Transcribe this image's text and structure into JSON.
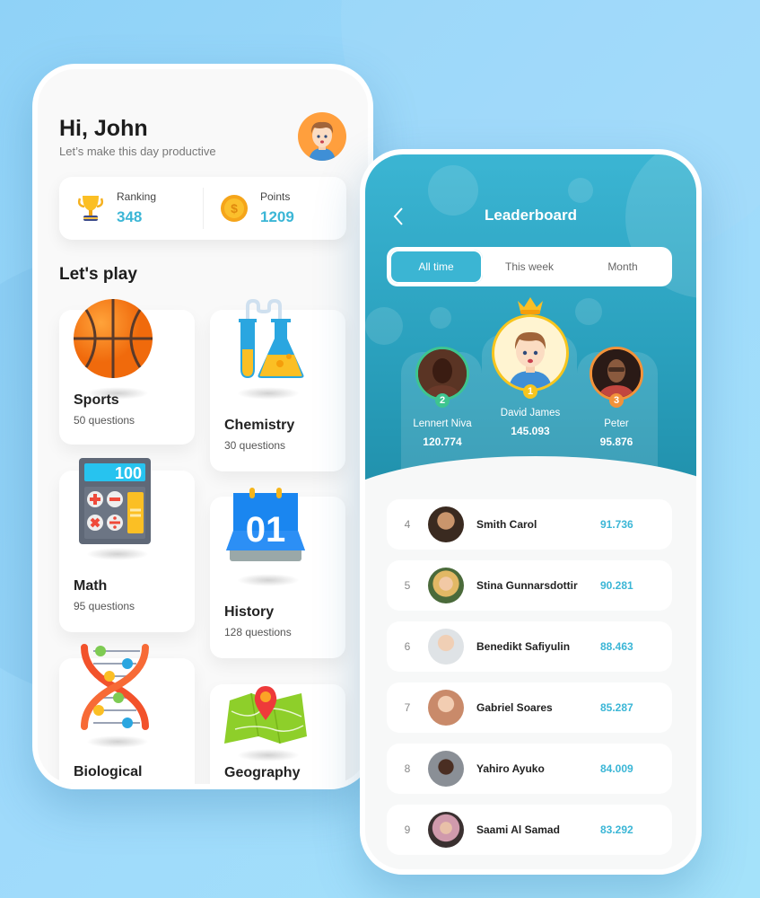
{
  "home": {
    "greeting": "Hi, John",
    "subtitle": "Let’s make this day productive",
    "stats": [
      {
        "label": "Ranking",
        "value": "348",
        "icon": "trophy-icon"
      },
      {
        "label": "Points",
        "value": "1209",
        "icon": "coin-icon"
      }
    ],
    "section_title": "Let's play",
    "categories": [
      {
        "title": "Sports",
        "count": "50 questions",
        "icon": "basketball-icon"
      },
      {
        "title": "Chemistry",
        "count": "30 questions",
        "icon": "test-tubes-icon"
      },
      {
        "title": "Math",
        "count": "95 questions",
        "icon": "calculator-icon",
        "display": "100"
      },
      {
        "title": "History",
        "count": "128 questions",
        "icon": "calendar-icon",
        "display": "01"
      },
      {
        "title": "Biological",
        "count": "",
        "icon": "dna-icon"
      },
      {
        "title": "Geography",
        "count": "",
        "icon": "map-pin-icon"
      }
    ]
  },
  "leaderboard": {
    "title": "Leaderboard",
    "tabs": [
      {
        "label": "All time",
        "active": true
      },
      {
        "label": "This week",
        "active": false
      },
      {
        "label": "Month",
        "active": false
      }
    ],
    "podium": [
      {
        "rank": "1",
        "name": "David James",
        "score": "145.093"
      },
      {
        "rank": "2",
        "name": "Lennert Niva",
        "score": "120.774"
      },
      {
        "rank": "3",
        "name": "Peter",
        "score": "95.876"
      }
    ],
    "rows": [
      {
        "rank": "4",
        "name": "Smith Carol",
        "score": "91.736"
      },
      {
        "rank": "5",
        "name": "Stina Gunnarsdottir",
        "score": "90.281"
      },
      {
        "rank": "6",
        "name": "Benedikt Safiyulin",
        "score": "88.463"
      },
      {
        "rank": "7",
        "name": "Gabriel Soares",
        "score": "85.287"
      },
      {
        "rank": "8",
        "name": "Yahiro Ayuko",
        "score": "84.009"
      },
      {
        "rank": "9",
        "name": "Saami Al Samad",
        "score": "83.292"
      }
    ]
  },
  "colors": {
    "accent": "#3bb6d6",
    "header_top": "#3bb5d3",
    "header_bottom": "#1f8ea9",
    "gold": "#f7c51e",
    "silver_green": "#3ec58f",
    "bronze": "#f2923a"
  }
}
